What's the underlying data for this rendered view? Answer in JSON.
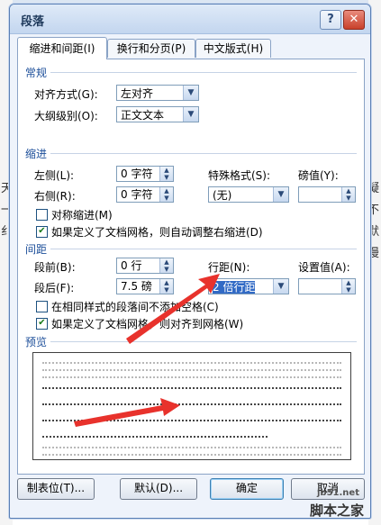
{
  "window": {
    "title": "段落"
  },
  "tabs": [
    {
      "label": "缩进和间距(I)",
      "active": true
    },
    {
      "label": "换行和分页(P)",
      "active": false
    },
    {
      "label": "中文版式(H)",
      "active": false
    }
  ],
  "general": {
    "heading": "常规",
    "alignment": {
      "label": "对齐方式(G):",
      "value": "左对齐"
    },
    "outline": {
      "label": "大纲级别(O):",
      "value": "正文文本"
    }
  },
  "indent": {
    "heading": "缩进",
    "left": {
      "label": "左侧(L):",
      "value": "0 字符"
    },
    "right": {
      "label": "右侧(R):",
      "value": "0 字符"
    },
    "special": {
      "label": "特殊格式(S):",
      "value": "(无)"
    },
    "measure": {
      "label": "磅值(Y):",
      "value": ""
    },
    "mirror": {
      "label": "对称缩进(M)",
      "checked": false
    },
    "auto_right": {
      "label": "如果定义了文档网格，则自动调整右缩进(D)",
      "checked": true
    }
  },
  "spacing": {
    "heading": "间距",
    "before": {
      "label": "段前(B):",
      "value": "0 行"
    },
    "after": {
      "label": "段后(F):",
      "value": "7.5 磅"
    },
    "line": {
      "label": "行距(N):",
      "value": "2 倍行距"
    },
    "at": {
      "label": "设置值(A):",
      "value": ""
    },
    "no_space": {
      "label": "在相同样式的段落间不添加空格(C)",
      "checked": false
    },
    "snap_grid": {
      "label": "如果定义了文档网格，则对齐到网格(W)",
      "checked": true
    }
  },
  "preview": {
    "heading": "预览"
  },
  "buttons": {
    "tabs": "制表位(T)...",
    "default": "默认(D)...",
    "ok": "确定",
    "cancel": "取消"
  },
  "background_text": [
    "天",
    "一",
    "纟",
    "凝",
    "不",
    "默",
    "慢"
  ],
  "watermark": {
    "site": "jb51.net",
    "name": "脚本之家"
  },
  "colors": {
    "accent": "#316ac5",
    "annotation_arrow": "#e8322c",
    "section_heading": "#1d4f9a"
  }
}
